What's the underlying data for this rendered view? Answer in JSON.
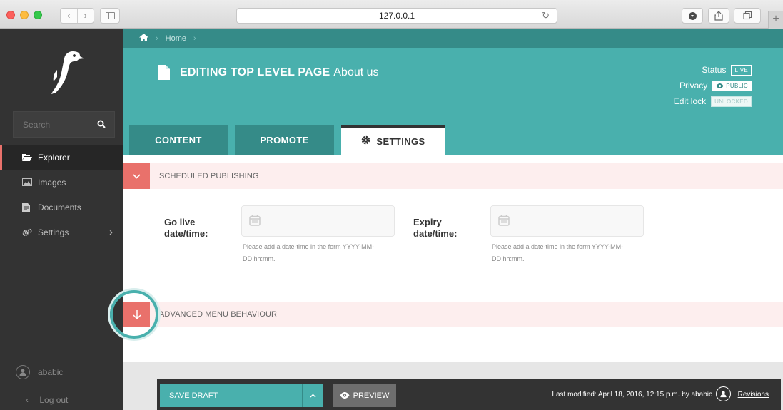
{
  "browser": {
    "url": "127.0.0.1",
    "nav_back": "‹",
    "nav_forward": "›",
    "new_tab": "+"
  },
  "sidebar": {
    "search_placeholder": "Search",
    "items": [
      {
        "label": "Explorer",
        "icon": "folder-open-icon",
        "active": true
      },
      {
        "label": "Images",
        "icon": "image-icon"
      },
      {
        "label": "Documents",
        "icon": "document-icon"
      },
      {
        "label": "Settings",
        "icon": "cogs-icon",
        "has_submenu": true
      }
    ],
    "user": "ababic",
    "logout": "Log out"
  },
  "breadcrumb": {
    "home_label": "Home"
  },
  "header": {
    "title_prefix": "EDITING TOP LEVEL PAGE",
    "page_title": "About us",
    "status_label": "Status",
    "status_value": "LIVE",
    "privacy_label": "Privacy",
    "privacy_value": "PUBLIC",
    "lock_label": "Edit lock",
    "lock_value": "UNLOCKED"
  },
  "tabs": [
    {
      "label": "CONTENT"
    },
    {
      "label": "PROMOTE"
    },
    {
      "label": "SETTINGS",
      "active": true
    }
  ],
  "sections": {
    "scheduled": "SCHEDULED PUBLISHING",
    "advanced": "ADVANCED MENU BEHAVIOUR"
  },
  "fields": {
    "go_live": {
      "label_line1": "Go live",
      "label_line2": "date/time:",
      "value": "",
      "help_line1": "Please add a date-time in the form YYYY-MM-",
      "help_line2": "DD hh:mm."
    },
    "expiry": {
      "label_line1": "Expiry",
      "label_line2": "date/time:",
      "value": "",
      "help_line1": "Please add a date-time in the form YYYY-MM-",
      "help_line2": "DD hh:mm."
    }
  },
  "footer": {
    "save_label": "SAVE DRAFT",
    "preview_label": "PREVIEW",
    "last_modified": "Last modified: April 18, 2016, 12:15 p.m. by ababic",
    "revisions": "Revisions"
  },
  "colors": {
    "teal": "#49b0ad",
    "teal_dark": "#358b88",
    "salmon": "#e9716b",
    "sidebar": "#333333"
  }
}
